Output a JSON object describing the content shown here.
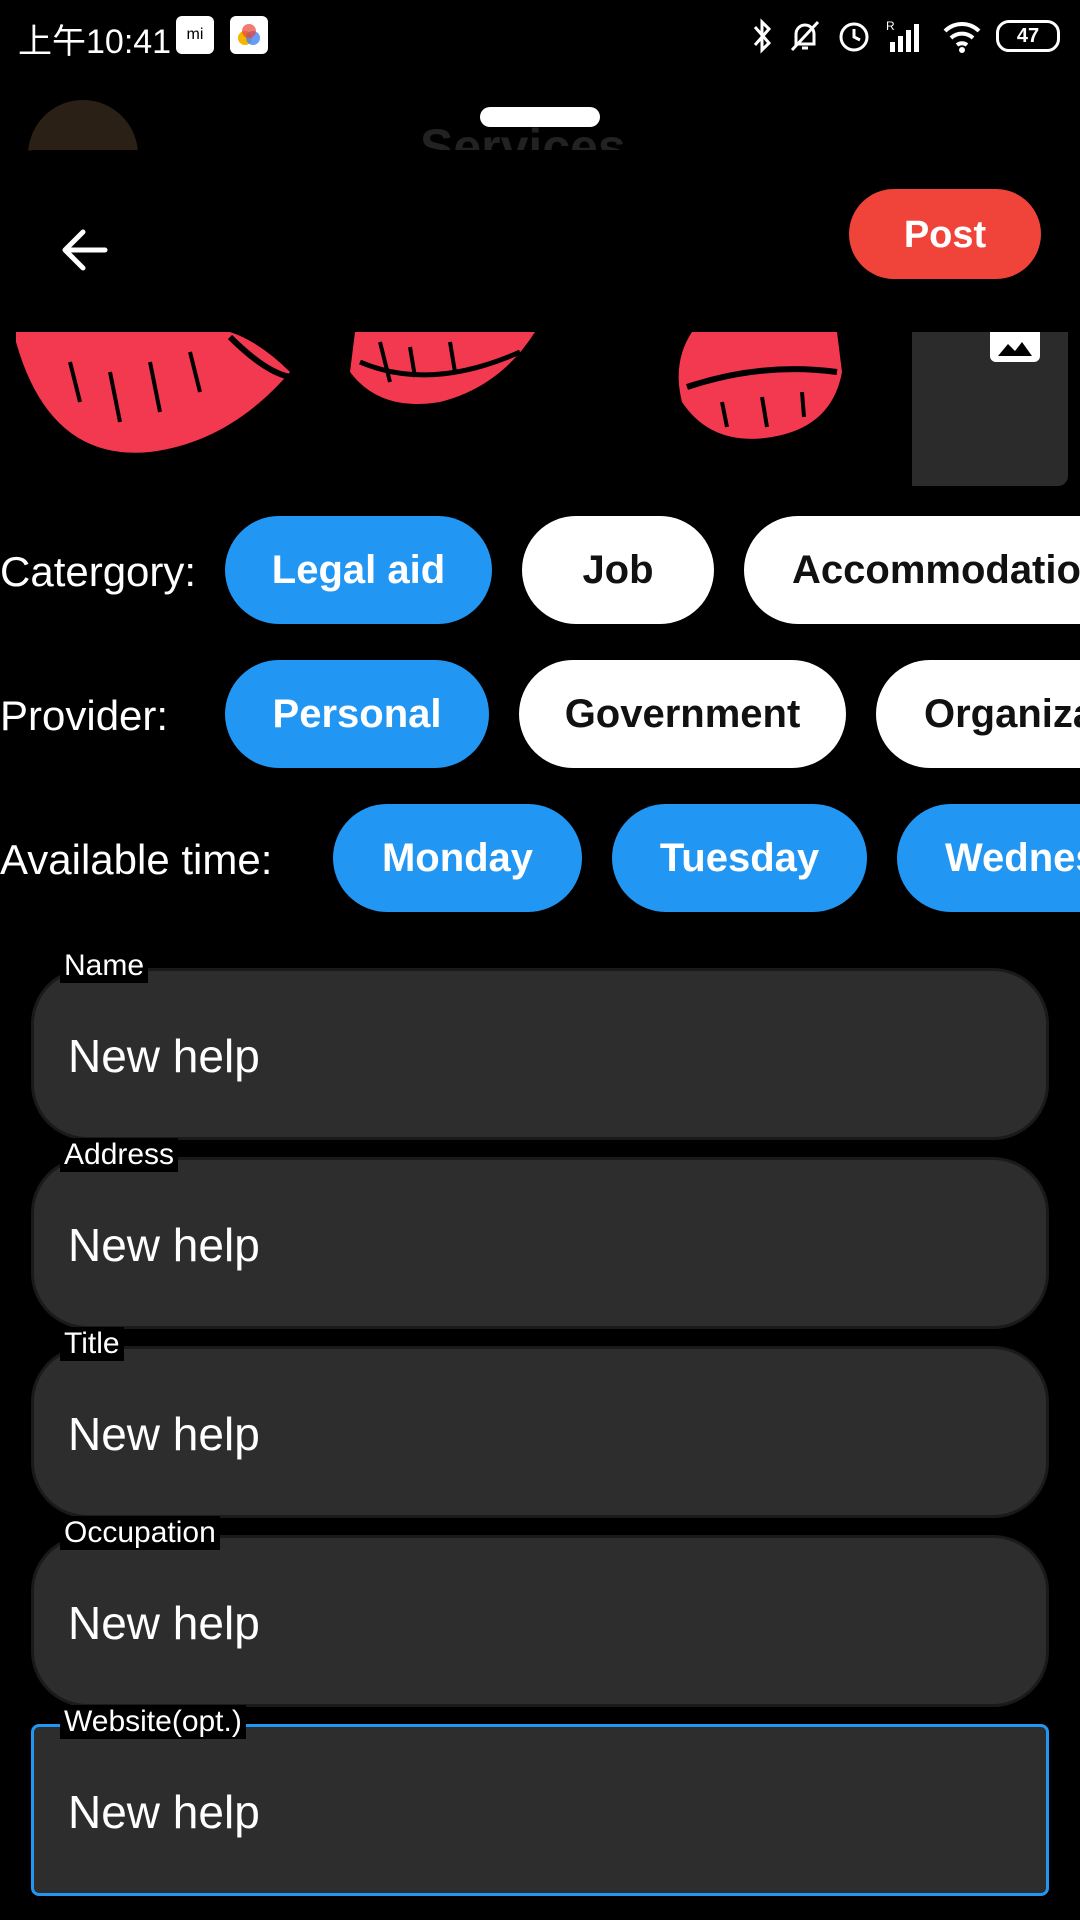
{
  "status_bar": {
    "time": "上午10:41",
    "battery": "47",
    "icons": [
      "mi-app-icon",
      "photos-app-icon",
      "bluetooth-icon",
      "mute-bell-icon",
      "alarm-icon",
      "signal-icon",
      "wifi-icon",
      "battery-icon"
    ]
  },
  "background": {
    "title": "Services"
  },
  "toolbar": {
    "back_icon": "arrow-left-icon",
    "post_label": "Post"
  },
  "images": {
    "add_icon": "image-icon"
  },
  "category": {
    "label": "Catergory:",
    "chips": [
      {
        "label": "Legal aid",
        "selected": true
      },
      {
        "label": "Job",
        "selected": false
      },
      {
        "label": "Accommodatio",
        "selected": false
      }
    ]
  },
  "provider": {
    "label": "Provider:",
    "chips": [
      {
        "label": "Personal",
        "selected": true
      },
      {
        "label": "Government",
        "selected": false
      },
      {
        "label": "Organiza",
        "selected": false
      }
    ]
  },
  "available_time": {
    "label": "Available time:",
    "chips": [
      {
        "label": "Monday",
        "selected": true
      },
      {
        "label": "Tuesday",
        "selected": true
      },
      {
        "label": "Wednes",
        "selected": true
      }
    ]
  },
  "fields": [
    {
      "label": "Name",
      "value": "New help"
    },
    {
      "label": "Address",
      "value": "New help"
    },
    {
      "label": "Title",
      "value": "New help"
    },
    {
      "label": "Occupation",
      "value": "New help"
    },
    {
      "label": "Website(opt.)",
      "value": "New help"
    }
  ],
  "colors": {
    "accent_blue": "#2196f3",
    "post_red": "#f0443a",
    "field_bg": "#2d2d2d",
    "lips_red": "#f2394f"
  }
}
